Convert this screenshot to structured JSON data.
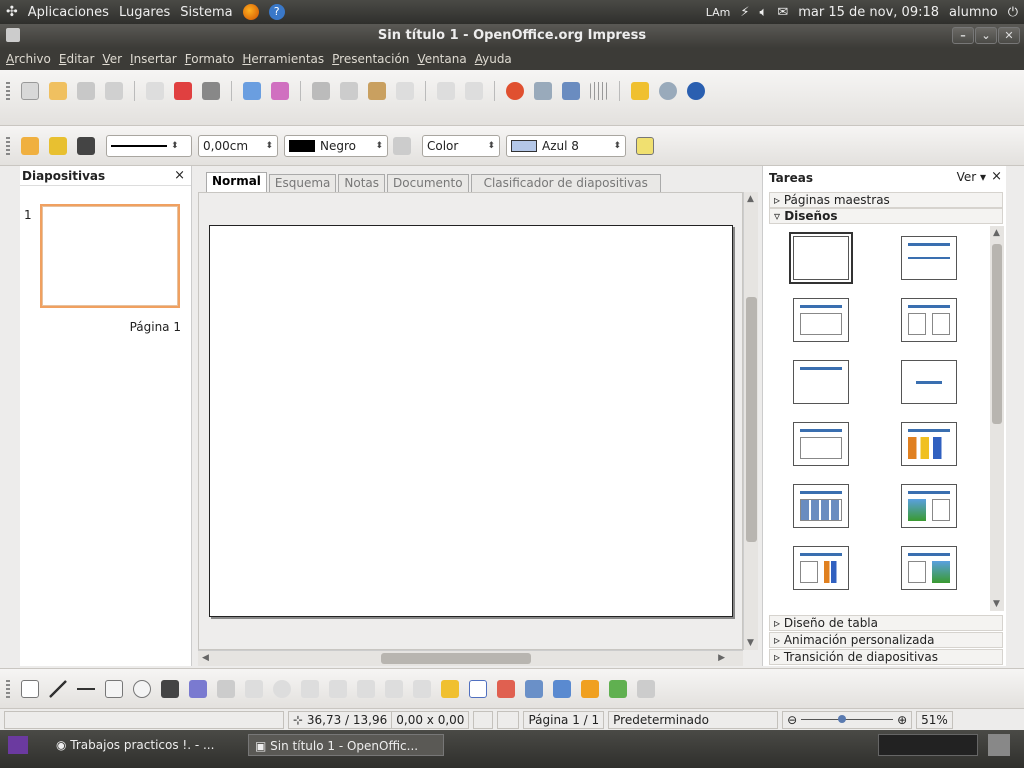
{
  "top_panel": {
    "menus": [
      "Aplicaciones",
      "Lugares",
      "Sistema"
    ],
    "keyboard": "LAm",
    "clock": "mar 15 de nov, 09:18",
    "user": "alumno"
  },
  "window": {
    "title": "Sin título 1 - OpenOffice.org Impress"
  },
  "menubar": [
    "Archivo",
    "Editar",
    "Ver",
    "Insertar",
    "Formato",
    "Herramientas",
    "Presentación",
    "Ventana",
    "Ayuda"
  ],
  "line_toolbar": {
    "width_value": "0,00cm",
    "line_color": "Negro",
    "fill_type": "Color",
    "fill_color": "Azul 8",
    "colors": {
      "negro": "#000000",
      "azul8": "#b4c7e7"
    }
  },
  "slides_pane": {
    "title": "Diapositivas",
    "close": "×",
    "slide_number": "1",
    "slide_caption": "Página 1"
  },
  "tabs": [
    "Normal",
    "Esquema",
    "Notas",
    "Documento",
    "Clasificador de diapositivas"
  ],
  "tasks_pane": {
    "title": "Tareas",
    "view_label": "Ver",
    "close": "×",
    "sections_top": [
      "Páginas maestras",
      "Diseños"
    ],
    "sections_bottom": [
      "Diseño de tabla",
      "Animación personalizada",
      "Transición de diapositivas"
    ]
  },
  "statusbar": {
    "position": "36,73 / 13,96",
    "size": "0,00 x 0,00",
    "page": "Página 1 / 1",
    "style": "Predeterminado",
    "zoom": "51%"
  },
  "taskbar": {
    "tasks": [
      "Trabajos practicos !. - ...",
      "Sin título 1 - OpenOffic..."
    ]
  }
}
